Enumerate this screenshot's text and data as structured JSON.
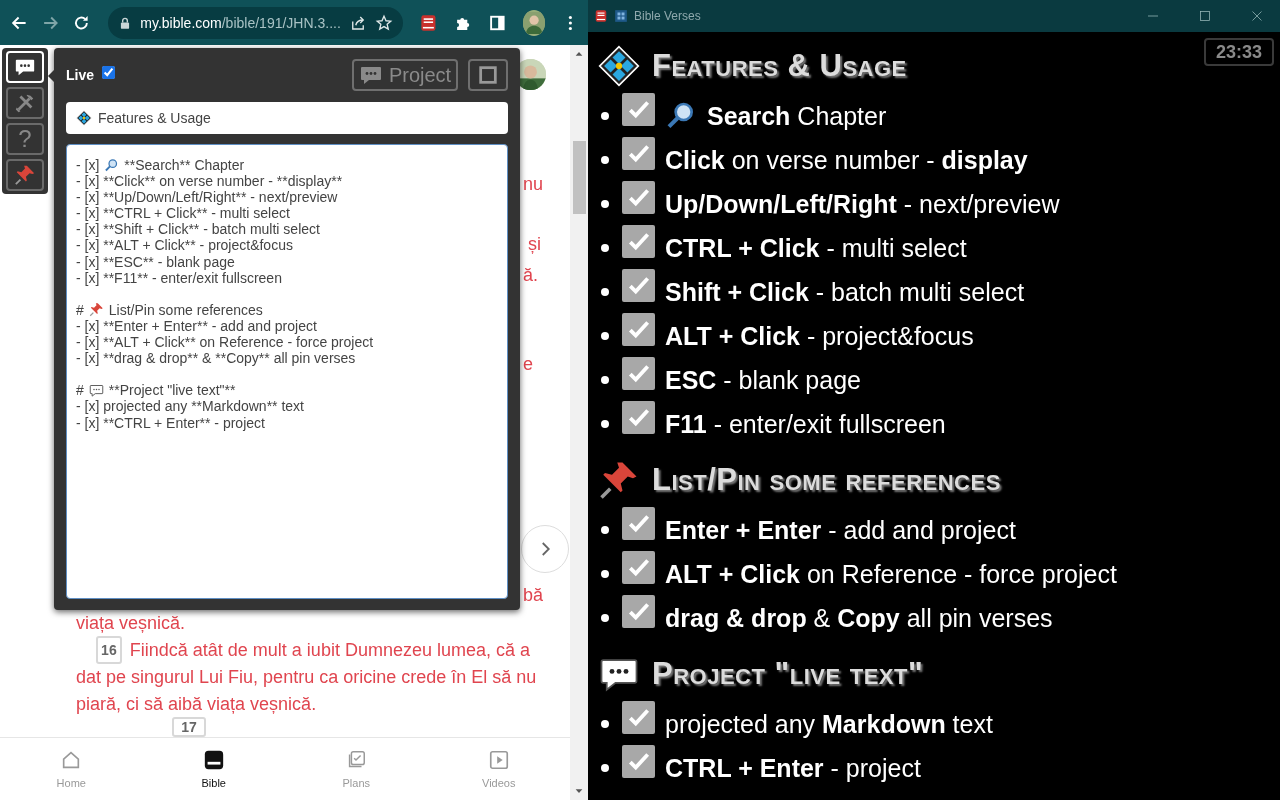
{
  "browser": {
    "nav": [
      {
        "kind": "back",
        "disabled": false
      },
      {
        "kind": "forward",
        "disabled": true
      },
      {
        "kind": "reload",
        "disabled": false
      }
    ],
    "address": {
      "host": "my.bible.com",
      "path": "/bible/191/JHN.3...."
    },
    "toolbar": [
      {
        "kind": "bible-app"
      },
      {
        "kind": "puzzle"
      },
      {
        "kind": "sidebar"
      },
      {
        "kind": "avatar"
      },
      {
        "kind": "menu"
      }
    ]
  },
  "page": {
    "peek_fragments": [
      "nu",
      "și",
      "ă.",
      "e",
      "bă"
    ],
    "verse_tail": "viața veșnică.",
    "verse": {
      "number": "16",
      "lines": [
        "Fiindcă atât de mult a iubit Dumnezeu lumea, că a",
        "dat pe singurul Lui Fiu, pentru ca oricine crede în El să nu",
        "piară, ci să aibă viața veșnică."
      ]
    },
    "next_verse_number": "17",
    "bottom_nav": [
      {
        "label": "Home",
        "kind": "home",
        "selected": false
      },
      {
        "label": "Bible",
        "kind": "bible",
        "selected": true
      },
      {
        "label": "Plans",
        "kind": "plans",
        "selected": false
      },
      {
        "label": "Videos",
        "kind": "videos",
        "selected": false
      }
    ]
  },
  "side_tools": [
    {
      "kind": "chat",
      "selected": true
    },
    {
      "kind": "tools",
      "selected": false
    },
    {
      "kind": "help",
      "label": "?",
      "selected": false
    },
    {
      "kind": "pin",
      "selected": false
    }
  ],
  "popup": {
    "live": {
      "label": "Live",
      "checked": true
    },
    "project_button": {
      "label": "Project",
      "disabled": true
    },
    "title_field": {
      "value": "Features & Usage"
    },
    "editor_lines": [
      {
        "kind": "search",
        "prefix": "- [x]",
        "text": "**Search** Chapter"
      },
      {
        "kind": "line",
        "prefix": "- [x]",
        "text": "**Click** on verse number - **display**"
      },
      {
        "kind": "line",
        "prefix": "- [x]",
        "text": "**Up/Down/Left/Right** - next/preview"
      },
      {
        "kind": "line",
        "prefix": "- [x]",
        "text": "**CTRL + Click** - multi select"
      },
      {
        "kind": "line",
        "prefix": "- [x]",
        "text": "**Shift + Click** - batch multi select"
      },
      {
        "kind": "line",
        "prefix": "- [x]",
        "text": "**ALT + Click** - project&focus"
      },
      {
        "kind": "line",
        "prefix": "- [x]",
        "text": "**ESC** - blank page"
      },
      {
        "kind": "line",
        "prefix": "- [x]",
        "text": "**F11** - enter/exit fullscreen"
      },
      {
        "kind": "blank"
      },
      {
        "kind": "pin",
        "prefix": "#",
        "text": "List/Pin some references"
      },
      {
        "kind": "line",
        "prefix": "- [x]",
        "text": "**Enter + Enter** - add and project"
      },
      {
        "kind": "line",
        "prefix": "- [x]",
        "text": "**ALT + Click** on Reference - force project"
      },
      {
        "kind": "line",
        "prefix": "- [x]",
        "text": "**drag & drop** & **Copy** all pin verses"
      },
      {
        "kind": "blank"
      },
      {
        "kind": "chat",
        "prefix": "#",
        "text": "**Project \"live text\"**"
      },
      {
        "kind": "line",
        "prefix": "- [x]",
        "text": "projected any **Markdown** text"
      },
      {
        "kind": "line",
        "prefix": "- [x]",
        "text": "**CTRL + Enter** - project"
      }
    ]
  },
  "window": {
    "title": "Bible Verses",
    "clock": "23:33",
    "sections": [
      {
        "kind": "diamond",
        "title": "Features & Usage",
        "items": [
          {
            "checked": true,
            "kind": "search",
            "text": "**Search** Chapter"
          },
          {
            "checked": true,
            "text": "**Click** on verse number - **display**"
          },
          {
            "checked": true,
            "text": "**Up/Down/Left/Right** - next/preview"
          },
          {
            "checked": true,
            "text": "**CTRL + Click** - multi select"
          },
          {
            "checked": true,
            "text": "**Shift + Click** - batch multi select"
          },
          {
            "checked": true,
            "text": "**ALT + Click** - project&focus"
          },
          {
            "checked": true,
            "text": "**ESC** - blank page"
          },
          {
            "checked": true,
            "text": "**F11** - enter/exit fullscreen"
          }
        ]
      },
      {
        "kind": "pin",
        "title": "List/Pin some references",
        "items": [
          {
            "checked": true,
            "text": "**Enter + Enter** - add and project"
          },
          {
            "checked": true,
            "text": "**ALT + Click** on Reference - force project"
          },
          {
            "checked": true,
            "text": "**drag & drop** & **Copy** all pin verses"
          }
        ]
      },
      {
        "kind": "chat",
        "title": "Project \"live text\"",
        "items": [
          {
            "checked": true,
            "text": "projected any **Markdown** text"
          },
          {
            "checked": true,
            "text": "**CTRL + Enter** - project"
          }
        ]
      }
    ]
  }
}
